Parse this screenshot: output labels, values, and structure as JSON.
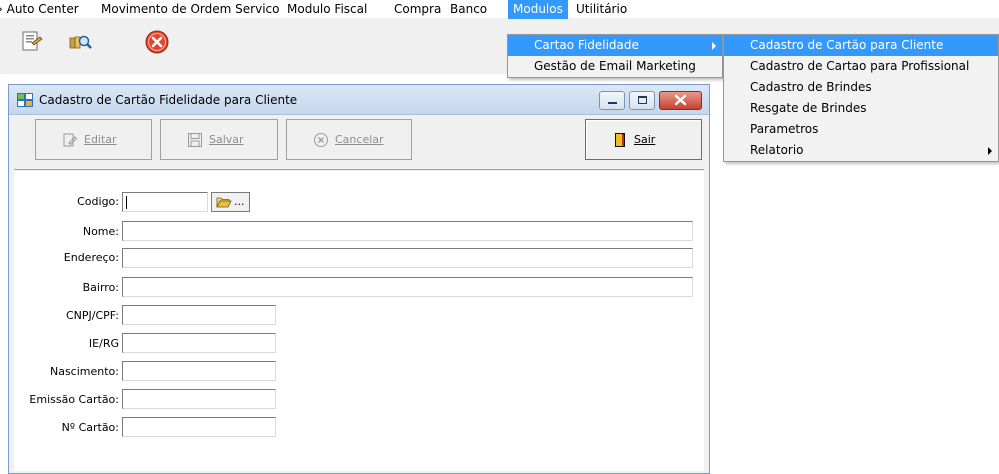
{
  "menubar": {
    "items": [
      "› Auto Center",
      "Movimento de Ordem Servico",
      "Modulo Fiscal",
      "Compra",
      "Banco",
      "Modulos",
      "Utilitário"
    ]
  },
  "toolbar": {
    "icons": [
      "document-icon",
      "search-icon",
      "close-icon"
    ]
  },
  "modulos_menu": {
    "items": [
      "Cartao Fidelidade",
      "Gestão de Email Marketing"
    ]
  },
  "cartao_submenu": {
    "items": [
      "Cadastro de Cartão para Cliente",
      "Cadastro de Cartao para Profissional",
      "Cadastro de Brindes",
      "Resgate de Brindes",
      "Parametros",
      "Relatorio"
    ]
  },
  "window": {
    "title": "Cadastro de Cartão Fidelidade para Cliente",
    "buttons": {
      "editar": "Editar",
      "salvar": "Salvar",
      "cancelar": "Cancelar",
      "sair": "Sair"
    },
    "browse_label": "...",
    "fields": {
      "codigo": {
        "label": "Codigo:",
        "value": ""
      },
      "nome": {
        "label": "Nome:",
        "value": ""
      },
      "endereco": {
        "label": "Endereço:",
        "value": ""
      },
      "bairro": {
        "label": "Bairro:",
        "value": ""
      },
      "cnpj": {
        "label": "CNPJ/CPF:",
        "value": ""
      },
      "ie": {
        "label": "IE/RG",
        "value": ""
      },
      "nascimento": {
        "label": "Nascimento:",
        "value": ""
      },
      "emissao": {
        "label": "Emissão Cartão:",
        "value": ""
      },
      "numero": {
        "label": "Nº Cartão:",
        "value": ""
      }
    }
  },
  "colors": {
    "highlight": "#3399ff",
    "toolbar_bg": "#f0f0f0",
    "close_red": "#e2452f"
  }
}
